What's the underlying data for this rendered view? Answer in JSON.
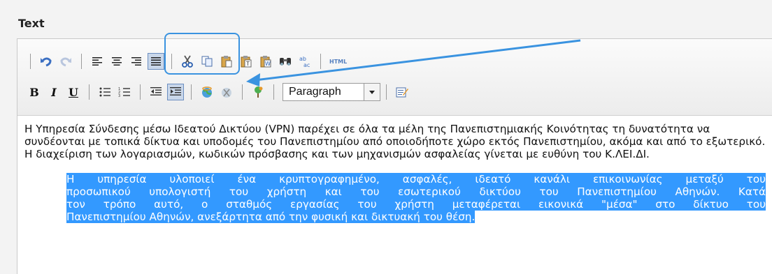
{
  "field_label": "Text",
  "toolbar": {
    "html_label": "HTML",
    "format_select_value": "Paragraph"
  },
  "content": {
    "p1": "Η Υπηρεσία Σύνδεσης μέσω Ιδεατού Δικτύου (VPN) παρέχει σε όλα τα μέλη της Πανεπιστημιακής Κοινότητας τη δυνατότητα να συνδέονται με τοπικά δίκτυα και υποδομές του Πανεπιστημίου από οποιοδήποτε χώρο εκτός Πανεπιστημίου, ακόμα και από το εξωτερικό. Η διαχείριση των λογαριασμών, κωδικών πρόσβασης και των μηχανισμών ασφαλείας γίνεται με ευθύνη του Κ.ΛΕΙ.ΔΙ.",
    "p2_lines": [
      "Η υπηρεσία υλοποιεί ένα κρυπτογραφημένο, ασφαλές, ιδεατό κανάλι επικοινωνίας μεταξύ του",
      "προσωπικού υπολογιστή του χρήστη και του εσωτερικού δικτύου του Πανεπιστημίου Αθηνών. Κατά",
      "τον τρόπο αυτό, ο σταθμός εργασίας του χρήστη μεταφέρεται εικονικά \"μέσα\" στο δίκτυο του",
      "Πανεπιστημίου Αθηνών, ανεξάρτητα από την φυσική και δικτυακή του θέση."
    ]
  },
  "colors": {
    "selection": "#3399ff",
    "annotation": "#3a93e0",
    "active_button": "#c9d7ea"
  }
}
